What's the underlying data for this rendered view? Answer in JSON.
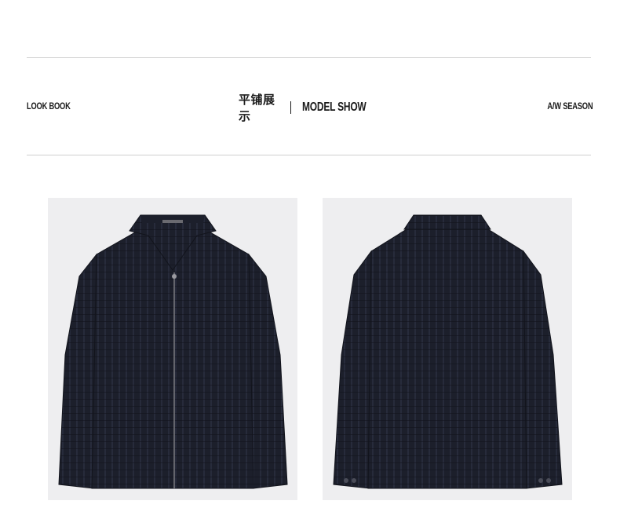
{
  "header": {
    "left_label": "LOOK BOOK",
    "center_cn": "平铺展示",
    "center_en": "MODEL SHOW",
    "right_label": "A/W SEASON"
  },
  "images": {
    "front_name": "jacket-front-image",
    "back_name": "jacket-back-image"
  },
  "colors": {
    "jacket": "#1c1f2b",
    "jacket_shadow": "#12141c",
    "pattern": "#2c3042",
    "photo_bg": "#eeeef0",
    "rule": "#cfcfcf"
  }
}
